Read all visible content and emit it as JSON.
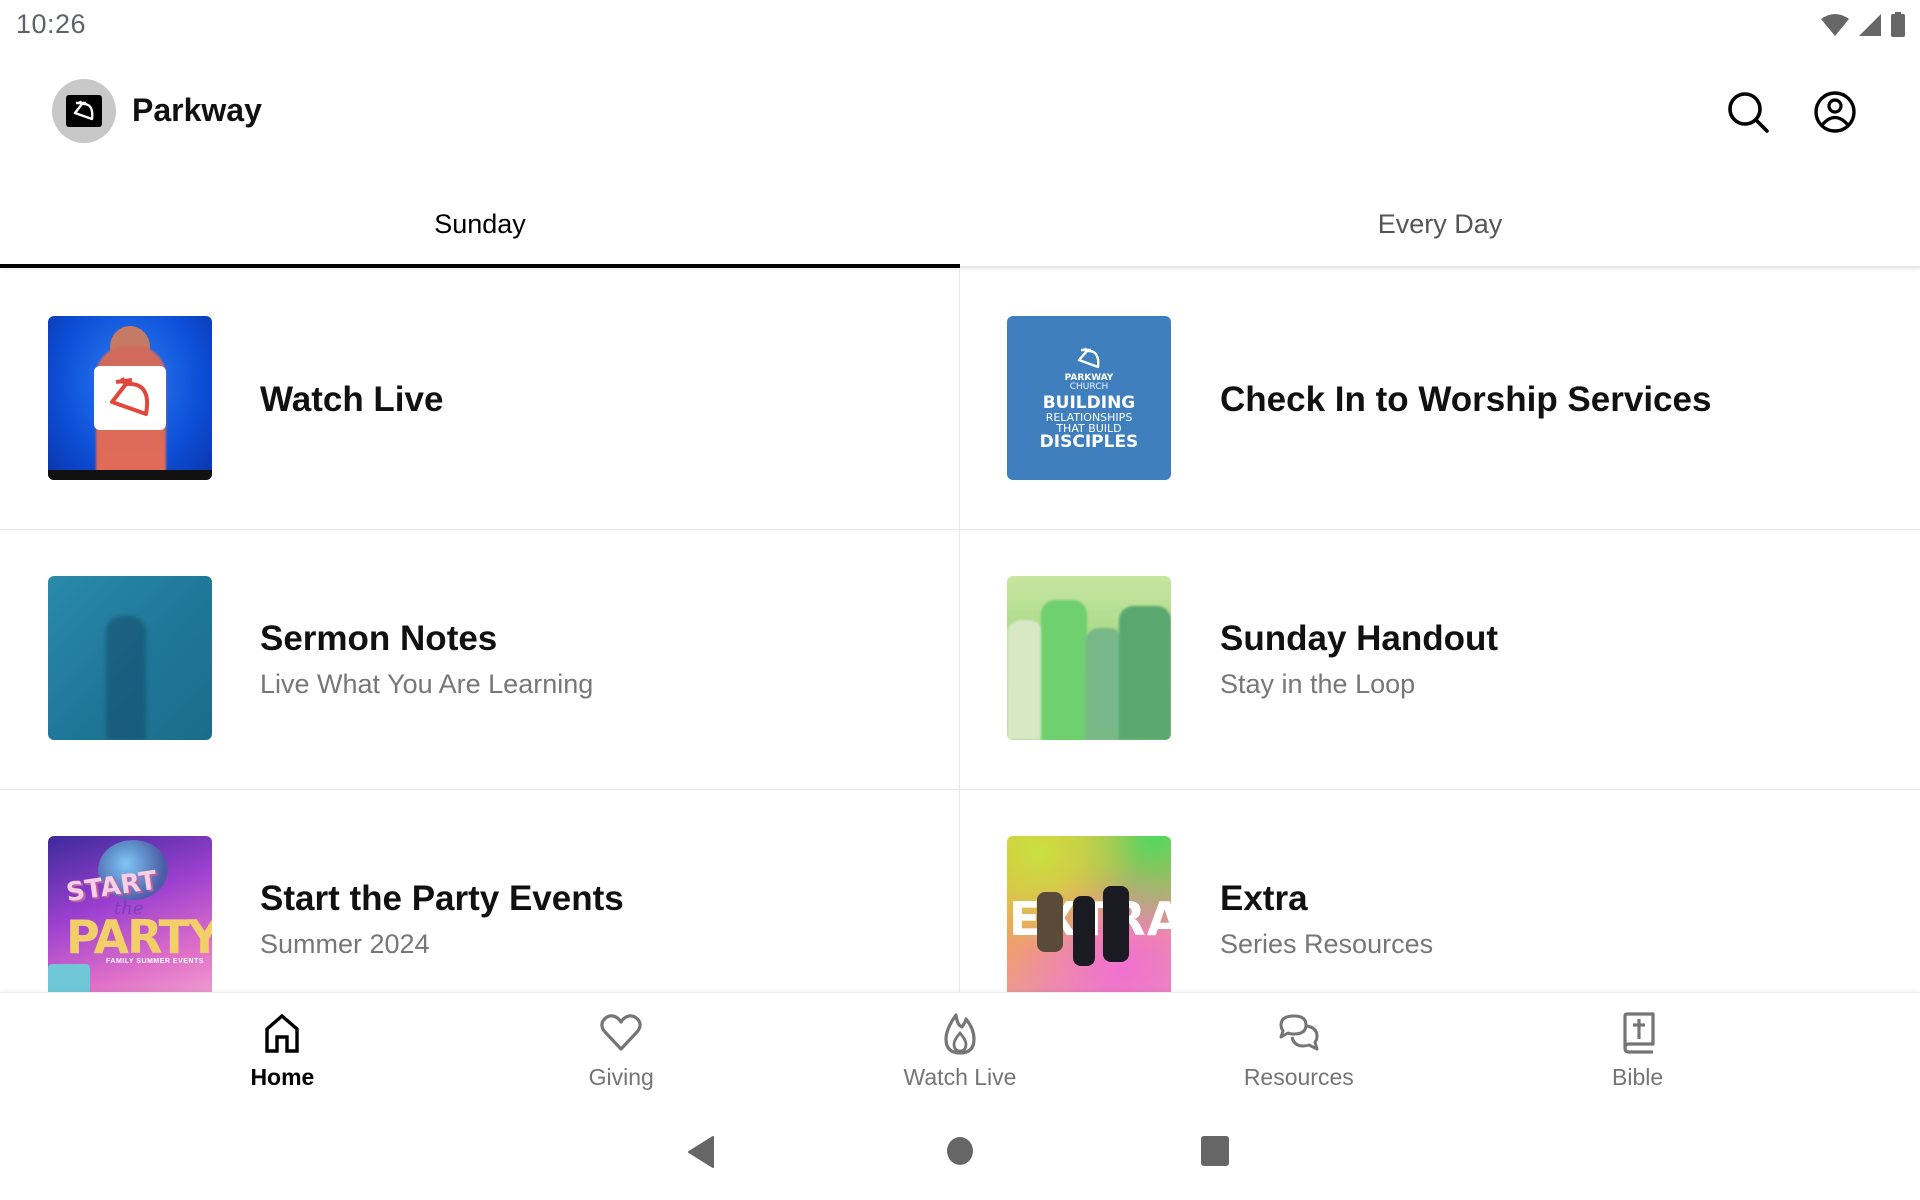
{
  "status_bar": {
    "time": "10:26",
    "icons": [
      "wifi-icon",
      "cellular-signal-icon",
      "battery-icon"
    ]
  },
  "app_bar": {
    "title": "Parkway",
    "logo": "parkway-logo-icon",
    "actions": [
      {
        "name": "search",
        "icon": "search-icon"
      },
      {
        "name": "account",
        "icon": "account-circle-icon"
      }
    ]
  },
  "tabs": [
    {
      "label": "Sunday",
      "selected": true
    },
    {
      "label": "Every Day",
      "selected": false
    }
  ],
  "cards": [
    {
      "title": "Watch Live",
      "subtitle": ""
    },
    {
      "title": "Check In to Worship Services",
      "subtitle": "",
      "thumb_text": [
        "PARKWAY",
        "CHURCH",
        "BUILDING",
        "RELATIONSHIPS",
        "THAT BUILD",
        "DISCIPLES"
      ]
    },
    {
      "title": "Sermon Notes",
      "subtitle": "Live What You Are Learning"
    },
    {
      "title": "Sunday Handout",
      "subtitle": "Stay in the Loop"
    },
    {
      "title": "Start the Party Events",
      "subtitle": "Summer 2024",
      "thumb_text": [
        "START",
        "the",
        "PARTY",
        "FAMILY SUMMER EVENTS"
      ]
    },
    {
      "title": "Extra",
      "subtitle": "Series Resources",
      "thumb_text": [
        "EXTRA"
      ]
    }
  ],
  "bottom_nav": [
    {
      "label": "Home",
      "icon": "home-icon",
      "active": true
    },
    {
      "label": "Giving",
      "icon": "heart-icon",
      "active": false
    },
    {
      "label": "Watch Live",
      "icon": "flame-icon",
      "active": false
    },
    {
      "label": "Resources",
      "icon": "chat-bubbles-icon",
      "active": false
    },
    {
      "label": "Bible",
      "icon": "bible-icon",
      "active": false
    }
  ],
  "system_nav": [
    "back",
    "home",
    "recents"
  ],
  "colors": {
    "active": "#000000",
    "inactive": "#757575",
    "subtitle": "#777777",
    "divider": "#e8e8e8"
  }
}
